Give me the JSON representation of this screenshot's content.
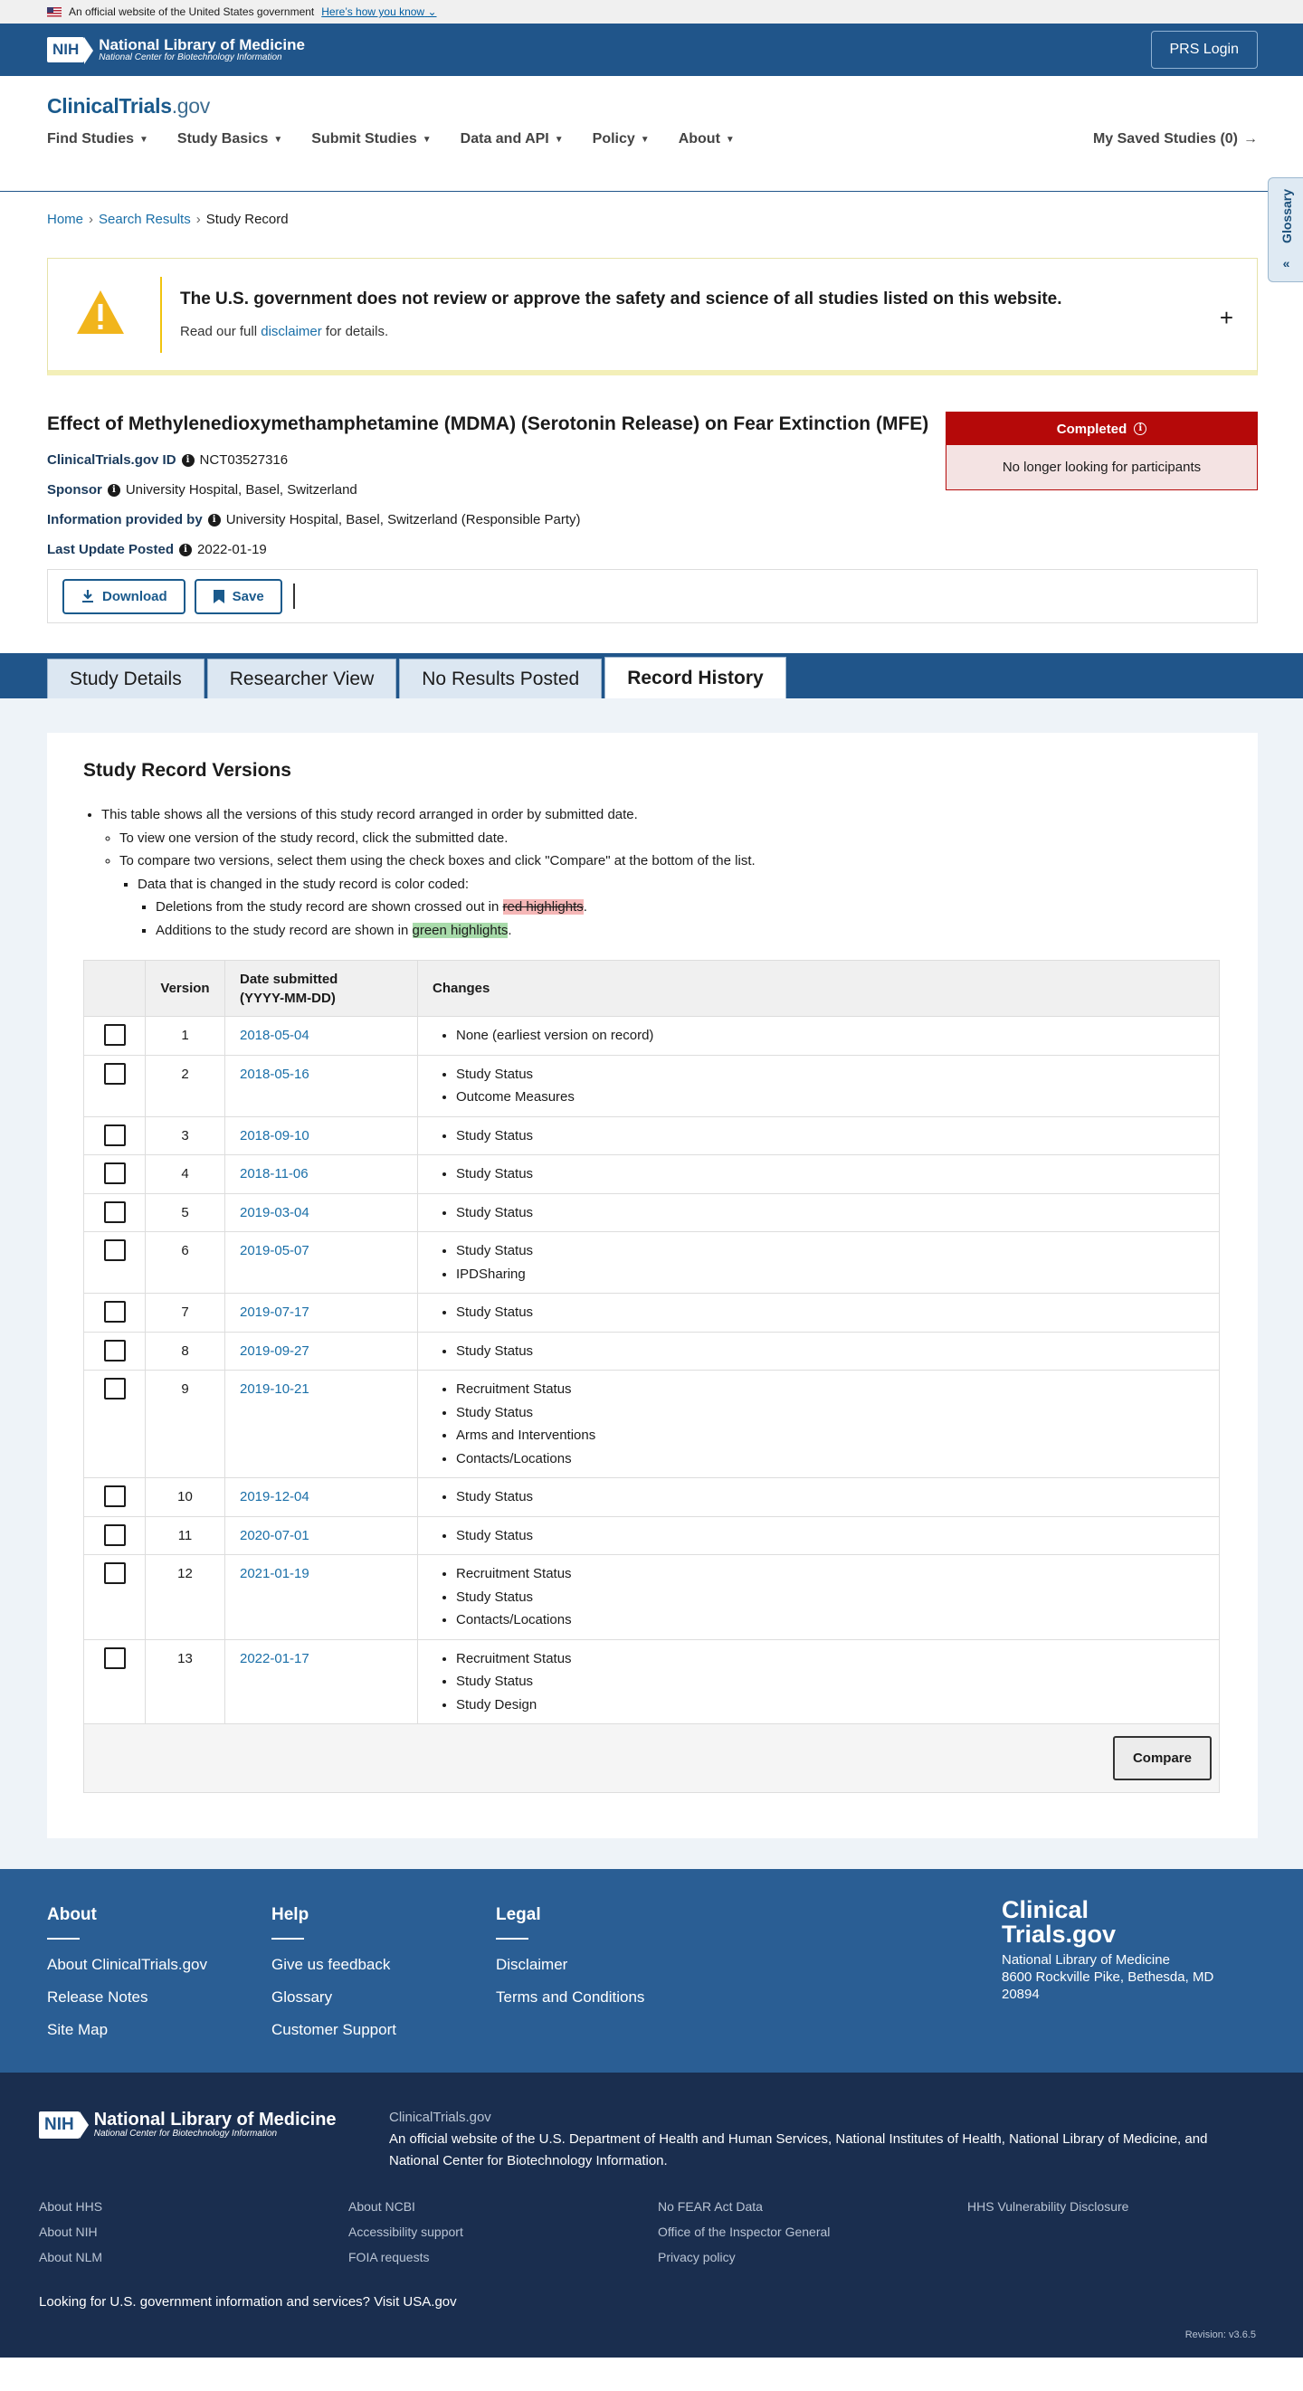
{
  "gov_banner": {
    "text": "An official website of the United States government",
    "link": "Here’s how you know"
  },
  "nih_header": {
    "logo_box": "NIH",
    "logo_title": "National Library of Medicine",
    "logo_subtitle": "National Center for Biotechnology Information",
    "login": "PRS Login"
  },
  "site": {
    "logo_main": "ClinicalTrials",
    "logo_suffix": ".gov"
  },
  "nav": {
    "items": [
      "Find Studies",
      "Study Basics",
      "Submit Studies",
      "Data and API",
      "Policy",
      "About"
    ],
    "saved": "My Saved Studies (0)"
  },
  "breadcrumb": {
    "home": "Home",
    "results": "Search Results",
    "current": "Study Record"
  },
  "glossary": "Glossary",
  "disclaimer": {
    "title": "The U.S. government does not review or approve the safety and science of all studies listed on this website.",
    "pre": "Read our full",
    "link": "disclaimer",
    "post": "for details."
  },
  "study": {
    "title": "Effect of Methylenedioxymethamphetamine (MDMA) (Serotonin Release) on Fear Extinction (MFE)",
    "id_label": "ClinicalTrials.gov ID",
    "id": "NCT03527316",
    "sponsor_label": "Sponsor",
    "sponsor": "University Hospital, Basel, Switzerland",
    "info_label": "Information provided by",
    "info": "University Hospital, Basel, Switzerland (Responsible Party)",
    "update_label": "Last Update Posted",
    "update": "2022-01-19",
    "status": "Completed",
    "status_sub": "No longer looking for participants"
  },
  "actions": {
    "download": "Download",
    "save": "Save"
  },
  "tabs": [
    "Study Details",
    "Researcher View",
    "No Results Posted",
    "Record History"
  ],
  "history": {
    "title": "Study Record Versions",
    "b1": "This table shows all the versions of this study record arranged in order by submitted date.",
    "b2": "To view one version of the study record, click the submitted date.",
    "b3": "To compare two versions, select them using the check boxes and click \"Compare\" at the bottom of the list.",
    "b4": "Data that is changed in the study record is color coded:",
    "b5_pre": "Deletions from the study record are shown crossed out in",
    "b5_mark": "red highlights",
    "b6_pre": "Additions to the study record are shown in",
    "b6_mark": "green highlights",
    "col_version": "Version",
    "col_date": "Date submitted",
    "col_date_fmt": "(YYYY-MM-DD)",
    "col_changes": "Changes",
    "compare": "Compare",
    "rows": [
      {
        "v": "1",
        "d": "2018-05-04",
        "c": [
          "None (earliest version on record)"
        ]
      },
      {
        "v": "2",
        "d": "2018-05-16",
        "c": [
          "Study Status",
          "Outcome Measures"
        ]
      },
      {
        "v": "3",
        "d": "2018-09-10",
        "c": [
          "Study Status"
        ]
      },
      {
        "v": "4",
        "d": "2018-11-06",
        "c": [
          "Study Status"
        ]
      },
      {
        "v": "5",
        "d": "2019-03-04",
        "c": [
          "Study Status"
        ]
      },
      {
        "v": "6",
        "d": "2019-05-07",
        "c": [
          "Study Status",
          "IPDSharing"
        ]
      },
      {
        "v": "7",
        "d": "2019-07-17",
        "c": [
          "Study Status"
        ]
      },
      {
        "v": "8",
        "d": "2019-09-27",
        "c": [
          "Study Status"
        ]
      },
      {
        "v": "9",
        "d": "2019-10-21",
        "c": [
          "Recruitment Status",
          "Study Status",
          "Arms and Interventions",
          "Contacts/Locations"
        ]
      },
      {
        "v": "10",
        "d": "2019-12-04",
        "c": [
          "Study Status"
        ]
      },
      {
        "v": "11",
        "d": "2020-07-01",
        "c": [
          "Study Status"
        ]
      },
      {
        "v": "12",
        "d": "2021-01-19",
        "c": [
          "Recruitment Status",
          "Study Status",
          "Contacts/Locations"
        ]
      },
      {
        "v": "13",
        "d": "2022-01-17",
        "c": [
          "Recruitment Status",
          "Study Status",
          "Study Design"
        ]
      }
    ]
  },
  "footer": {
    "about_h": "About",
    "about": [
      "About ClinicalTrials.gov",
      "Release Notes",
      "Site Map"
    ],
    "help_h": "Help",
    "help": [
      "Give us feedback",
      "Glossary",
      "Customer Support"
    ],
    "legal_h": "Legal",
    "legal": [
      "Disclaimer",
      "Terms and Conditions"
    ],
    "brand_1": "Clinical",
    "brand_2": "Trials.gov",
    "addr1": "National Library of Medicine",
    "addr2": "8600 Rockville Pike, Bethesda, MD",
    "addr3": "20894"
  },
  "footer2": {
    "site": "ClinicalTrials.gov",
    "pre": "An official website of the",
    "l1": "U.S. Department of Health and Human Services",
    "l2": "National Institutes of Health",
    "l3": "National Library of Medicine",
    "and": "and",
    "l4": "National Center for Biotechnology Information",
    "col1": [
      "About HHS",
      "About NIH",
      "About NLM"
    ],
    "col2": [
      "About NCBI",
      "Accessibility support",
      "FOIA requests"
    ],
    "col3": [
      "No FEAR Act Data",
      "Office of the Inspector General",
      "Privacy policy"
    ],
    "col4": [
      "HHS Vulnerability Disclosure"
    ],
    "usa_pre": "Looking for U.S. government information and services?",
    "usa_link": "Visit USA.gov",
    "revision": "Revision: v3.6.5"
  }
}
